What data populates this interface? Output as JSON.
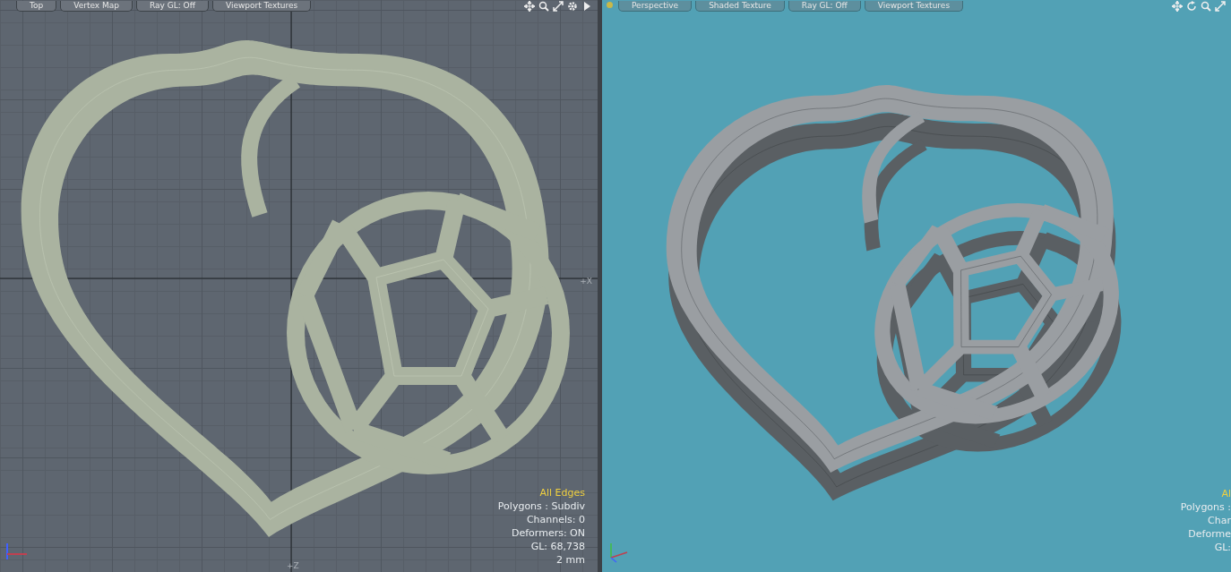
{
  "viewports": [
    {
      "kind": "ortho",
      "tabs": [
        "Top",
        "Vertex Map",
        "Ray GL: Off",
        "Viewport Textures"
      ],
      "axis_labels": [
        "+X",
        "+Z"
      ],
      "info": {
        "highlight": "All Edges",
        "lines": [
          "Polygons : Subdiv",
          "Channels: 0",
          "Deformers: ON",
          "GL: 68,738",
          "2 mm"
        ]
      }
    },
    {
      "kind": "perspective",
      "tabs": [
        "Perspective",
        "Shaded Texture",
        "Ray GL: Off",
        "Viewport Textures"
      ],
      "info": {
        "highlight": "Al",
        "lines": [
          "Polygons :",
          "Char",
          "Deforme",
          "GL:"
        ]
      }
    }
  ]
}
